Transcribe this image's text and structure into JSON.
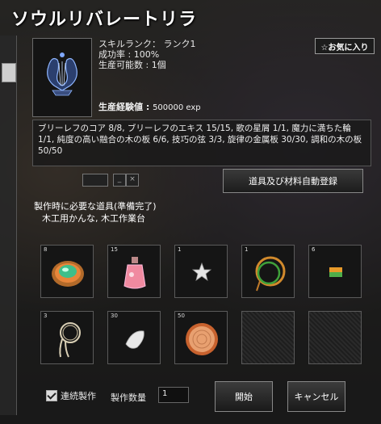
{
  "window": {
    "title": "ソウルリバレートリラ"
  },
  "skill": {
    "rank_label": "スキルランク：",
    "rank_value": "ランク1",
    "success_label": "成功率 : ",
    "success_value": "100%",
    "producible_label": "生産可能数 : ",
    "producible_value": "1個",
    "exp_label": "生産経験値",
    "exp_value": "500000 exp"
  },
  "favorite_label": "☆お気に入り",
  "materials_text": "ブリーレフのコア 8/8, ブリーレフのエキス 15/15, 歌の星屑 1/1, 魔力に満ちた輪 1/1, 純度の高い融合の木の板 6/6, 技巧の弦 3/3, 旋律の金属板 30/30, 調和の木の板 50/50",
  "auto_register_label": "道具及び材料自動登録",
  "required_tools": {
    "heading": "製作時に必要な道具(準備完了)",
    "tools": "木工用かんな, 木工作業台"
  },
  "slots": [
    {
      "count": "8",
      "icon": "core-orb-icon"
    },
    {
      "count": "15",
      "icon": "essence-potion-icon"
    },
    {
      "count": "1",
      "icon": "star-dust-icon"
    },
    {
      "count": "1",
      "icon": "magic-ring-icon"
    },
    {
      "count": "6",
      "icon": "wood-board-icon"
    },
    {
      "count": "3",
      "icon": "string-coil-icon"
    },
    {
      "count": "30",
      "icon": "metal-plate-icon"
    },
    {
      "count": "50",
      "icon": "wood-slice-icon"
    },
    {
      "count": "",
      "icon": "empty-slot"
    },
    {
      "count": "",
      "icon": "empty-slot"
    }
  ],
  "continuous_label": "連続製作",
  "continuous_checked": true,
  "quantity_label": "製作数量",
  "quantity_value": "1",
  "start_label": "開始",
  "cancel_label": "キャンセル"
}
